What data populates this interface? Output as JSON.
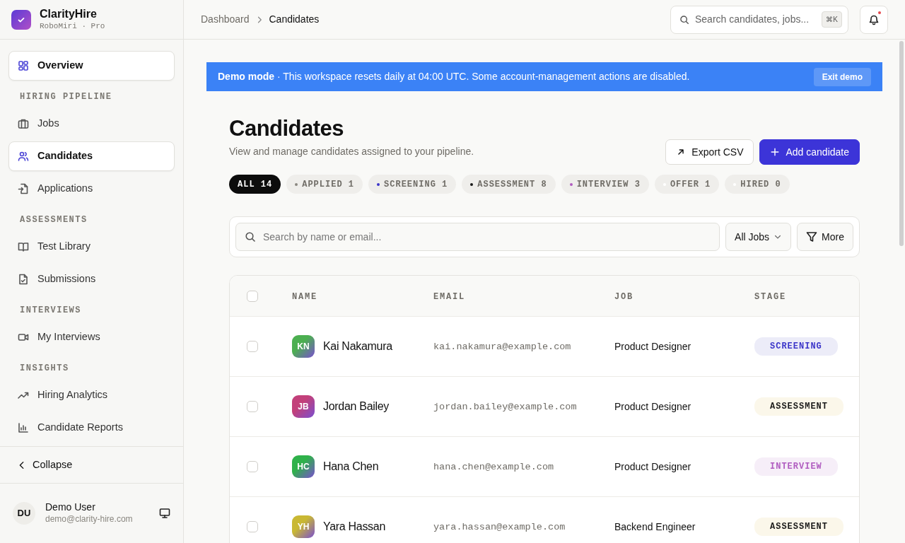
{
  "brand": {
    "name": "ClarityHire",
    "subtitle": "RoboMiri · Pro"
  },
  "sidebar": {
    "items": [
      {
        "kind": "item",
        "label": "Overview",
        "selected": true
      },
      {
        "kind": "heading",
        "label": "HIRING PIPELINE"
      },
      {
        "kind": "item",
        "label": "Jobs",
        "selected": false
      },
      {
        "kind": "item",
        "label": "Candidates",
        "selected": true
      },
      {
        "kind": "item",
        "label": "Applications",
        "selected": false
      },
      {
        "kind": "heading",
        "label": "ASSESSMENTS"
      },
      {
        "kind": "item",
        "label": "Test Library",
        "selected": false
      },
      {
        "kind": "item",
        "label": "Submissions",
        "selected": false
      },
      {
        "kind": "heading",
        "label": "INTERVIEWS"
      },
      {
        "kind": "item",
        "label": "My Interviews",
        "selected": false
      },
      {
        "kind": "heading",
        "label": "INSIGHTS"
      },
      {
        "kind": "item",
        "label": "Hiring Analytics",
        "selected": false
      },
      {
        "kind": "item",
        "label": "Candidate Reports",
        "selected": false
      }
    ],
    "collapse": "Collapse",
    "user": {
      "initials": "DU",
      "name": "Demo User",
      "email": "demo@clarity-hire.com"
    }
  },
  "breadcrumb": [
    "Dashboard",
    "Candidates"
  ],
  "top_search": {
    "placeholder": "Search candidates, jobs...",
    "shortcut": "⌘K"
  },
  "notifications": {
    "unread": true
  },
  "banner": {
    "text": "**Demo mode** · This workspace resets daily at 04:00 UTC. Some account-management actions are disabled.",
    "button": "Exit demo"
  },
  "page": {
    "title": "Candidates",
    "subtitle": "View and manage candidates assigned to your pipeline.",
    "buttons": [
      {
        "kind": "secondary",
        "label": "Export CSV"
      },
      {
        "kind": "primary",
        "label": "Add candidate"
      }
    ]
  },
  "filters": [
    {
      "label": "ALL 14",
      "selected": true
    },
    {
      "label": "APPLIED 1",
      "selected": false,
      "color": "#8a8780"
    },
    {
      "label": "SCREENING 1",
      "selected": false,
      "color": "#3b35c9"
    },
    {
      "label": "ASSESSMENT 8",
      "selected": false,
      "color": "#1a1a1a"
    },
    {
      "label": "INTERVIEW 3",
      "selected": false,
      "color": "#b05cc0"
    },
    {
      "label": "OFFER 1",
      "selected": false,
      "color": "#ffffff"
    },
    {
      "label": "HIRED 0",
      "selected": false,
      "color": "#ffffff"
    }
  ],
  "toolbar": {
    "search_placeholder": "Search by name or email...",
    "job_filter": "All Jobs",
    "more": "More"
  },
  "table": {
    "columns": [
      "NAME",
      "EMAIL",
      "JOB",
      "STAGE"
    ],
    "header_checked": false,
    "rows": [
      {
        "initials": "KN",
        "color": "#4caf50",
        "name": "Kai Nakamura",
        "email": "kai.nakamura@example.com",
        "job": "Product Designer",
        "stage": "SCREENING",
        "kind": "screening",
        "checked": false
      },
      {
        "initials": "JB",
        "color": "#c2407a",
        "name": "Jordan Bailey",
        "email": "jordan.bailey@example.com",
        "job": "Product Designer",
        "stage": "ASSESSMENT",
        "kind": "assessment",
        "checked": false
      },
      {
        "initials": "HC",
        "color": "#2fb14a",
        "name": "Hana Chen",
        "email": "hana.chen@example.com",
        "job": "Product Designer",
        "stage": "INTERVIEW",
        "kind": "interview",
        "checked": false
      },
      {
        "initials": "YH",
        "color": "#c9b833",
        "name": "Yara Hassan",
        "email": "yara.hassan@example.com",
        "job": "Backend Engineer",
        "stage": "ASSESSMENT",
        "kind": "assessment",
        "checked": false
      }
    ]
  }
}
